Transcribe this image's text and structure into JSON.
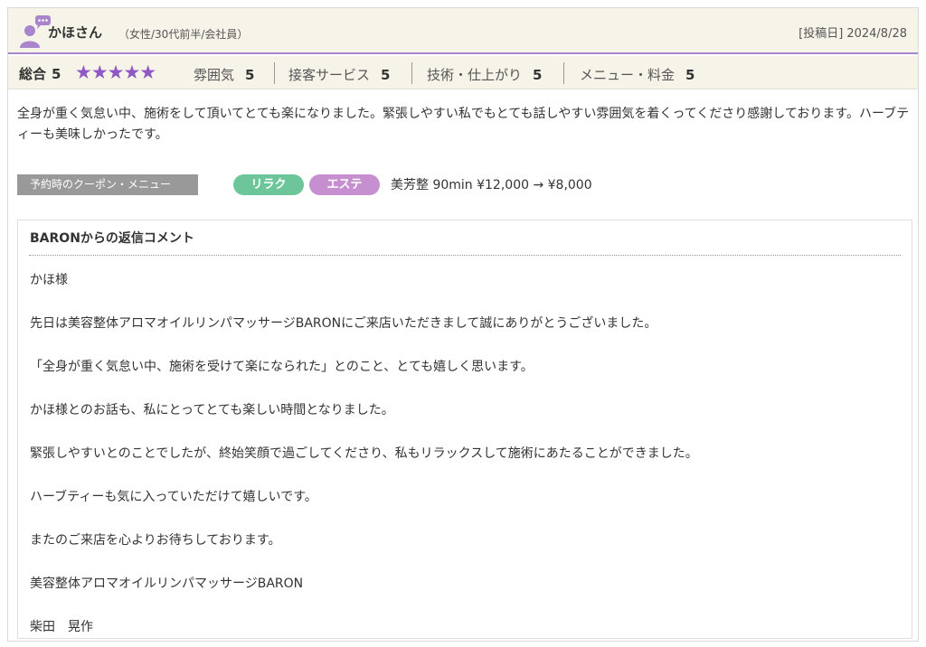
{
  "colors": {
    "accent": "#a985cc",
    "star": "#9058c4",
    "header_bg": "#f6f3e9",
    "relax_tag": "#6cc69a",
    "este_tag": "#c58fd0",
    "coupon_label_bg": "#999999"
  },
  "reviewer": {
    "icon": "user-speech-icon",
    "name": "かほさん",
    "profile": "（女性/30代前半/会社員）"
  },
  "post": {
    "date_label": "[投稿日]",
    "date": "2024/8/28"
  },
  "ratings": {
    "overall_label": "総合",
    "overall_value": "5",
    "stars": "★★★★★",
    "items": [
      {
        "label": "雰囲気",
        "value": "5"
      },
      {
        "label": "接客サービス",
        "value": "5"
      },
      {
        "label": "技術・仕上がり",
        "value": "5"
      },
      {
        "label": "メニュー・料金",
        "value": "5"
      }
    ]
  },
  "review": {
    "text": "全身が重く気怠い中、施術をして頂いてとても楽になりました。緊張しやすい私でもとても話しやすい雰囲気を着くってくださり感謝しております。ハーブティーも美味しかったです。"
  },
  "coupon": {
    "label": "予約時のクーポン・メニュー",
    "tags": [
      "リラク",
      "エステ"
    ],
    "menu": "美芳整 90min ¥12,000 → ¥8,000"
  },
  "reply": {
    "title": "BARONからの返信コメント",
    "lines": [
      "かほ様",
      "先日は美容整体アロマオイルリンパマッサージBARONにご来店いただきまして誠にありがとうございました。",
      "「全身が重く気怠い中、施術を受けて楽になられた」とのこと、とても嬉しく思います。",
      "かほ様とのお話も、私にとってとても楽しい時間となりました。",
      "緊張しやすいとのことでしたが、終始笑顔で過ごしてくださり、私もリラックスして施術にあたることができました。",
      "ハーブティーも気に入っていただけて嬉しいです。",
      "またのご来店を心よりお待ちしております。",
      "美容整体アロマオイルリンパマッサージBARON",
      "柴田　晃作"
    ]
  }
}
